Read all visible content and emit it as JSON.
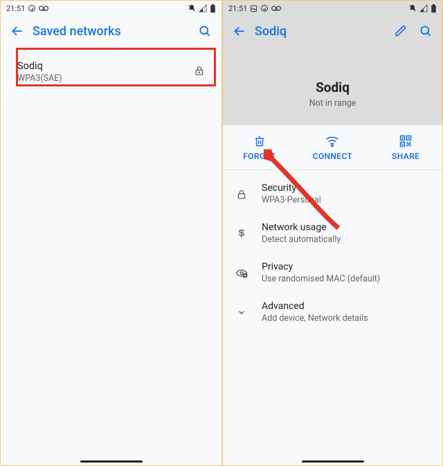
{
  "left": {
    "status": {
      "time": "21:51"
    },
    "appbar": {
      "title": "Saved networks"
    },
    "network": {
      "name": "Sodiq",
      "detail": "WPA3(SAE)"
    }
  },
  "right": {
    "status": {
      "time": "21:51"
    },
    "appbar": {
      "title": "Sodiq"
    },
    "hero": {
      "name": "Sodiq",
      "status": "Not in range"
    },
    "actions": {
      "forget": "FORGET",
      "connect": "CONNECT",
      "share": "SHARE"
    },
    "details": {
      "security": {
        "label": "Security",
        "value": "WPA3-Personal"
      },
      "network_usage": {
        "label": "Network usage",
        "value": "Detect automatically"
      },
      "privacy": {
        "label": "Privacy",
        "value": "Use randomised MAC (default)"
      },
      "advanced": {
        "label": "Advanced",
        "value": "Add device, Network details"
      }
    }
  },
  "colors": {
    "accent": "#1a73e8",
    "highlight": "#e1352b"
  }
}
